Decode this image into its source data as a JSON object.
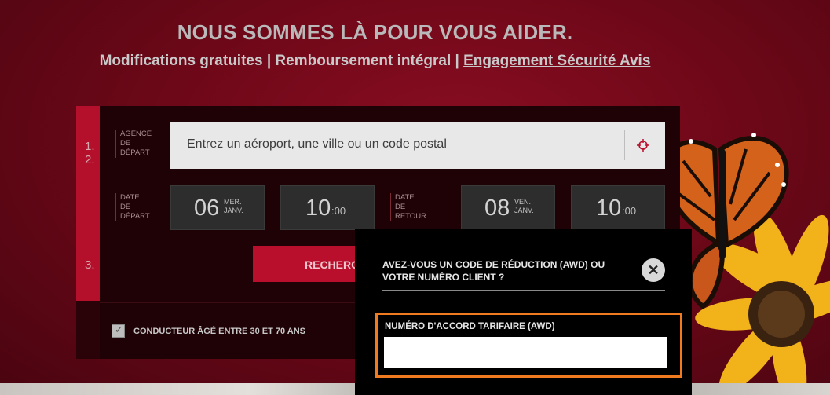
{
  "hero": {
    "title": "NOUS SOMMES LÀ POUR VOUS AIDER.",
    "subtitle_part1": "Modifications gratuites | Remboursement intégral | ",
    "subtitle_link": "Engagement Sécurité Avis"
  },
  "steps": [
    "1.",
    "2.",
    "3."
  ],
  "pickup": {
    "label_lines": [
      "AGENCE",
      "DE",
      "DÉPART"
    ],
    "placeholder": "Entrez un aéroport, une ville ou un code postal",
    "icon": "crosshair-icon"
  },
  "departure": {
    "label_lines": [
      "DATE",
      "DE",
      "DÉPART"
    ],
    "day": "06",
    "weekday": "MER.",
    "month": "JANV.",
    "hour": "10",
    "minutes": ":00"
  },
  "return": {
    "label_lines": [
      "DATE",
      "DE",
      "RETOUR"
    ],
    "day": "08",
    "weekday": "VEN.",
    "month": "JANV.",
    "hour": "10",
    "minutes": ":00"
  },
  "search_button": "RECHERC",
  "driver_age": {
    "checked": true,
    "label": "CONDUCTEUR ÂGÉ ENTRE 30 ET 70 ANS"
  },
  "popup": {
    "title": "AVEZ-VOUS UN CODE DE RÉDUCTION (AWD) OU VOTRE NUMÉRO CLIENT ?",
    "close_icon": "close-icon",
    "awd_label": "NUMÉRO D'ACCORD TARIFAIRE (AWD)",
    "awd_value": ""
  },
  "colors": {
    "brand_red": "#b90f2c",
    "highlight": "#f07a20"
  }
}
